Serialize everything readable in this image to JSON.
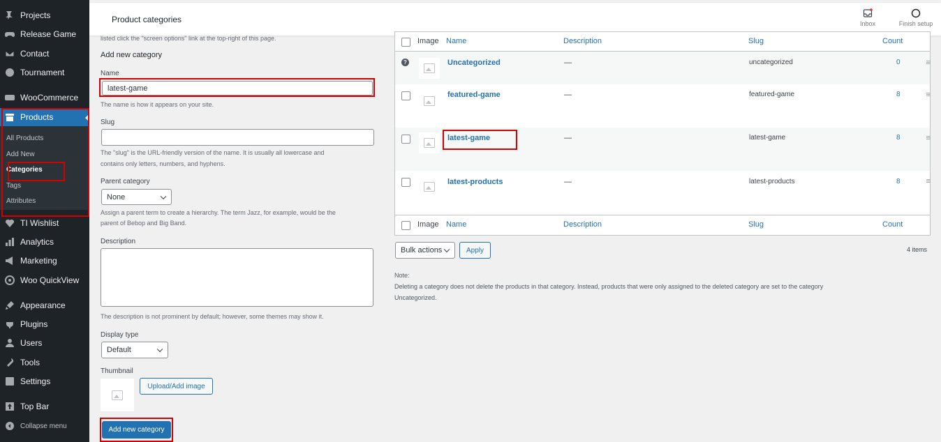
{
  "sidebar": {
    "items": [
      {
        "label": "Projects",
        "icon": "pin-icon"
      },
      {
        "label": "Release Game",
        "icon": "gamepad-icon"
      },
      {
        "label": "Contact",
        "icon": "mail-icon"
      },
      {
        "label": "Tournament",
        "icon": "trophy-icon"
      },
      {
        "label": "WooCommerce",
        "icon": "woo-icon"
      },
      {
        "label": "Products",
        "icon": "archive-icon"
      },
      {
        "label": "TI Wishlist",
        "icon": "heart-icon"
      },
      {
        "label": "Analytics",
        "icon": "chart-icon"
      },
      {
        "label": "Marketing",
        "icon": "megaphone-icon"
      },
      {
        "label": "Woo QuickView",
        "icon": "eye-icon"
      },
      {
        "label": "Appearance",
        "icon": "brush-icon"
      },
      {
        "label": "Plugins",
        "icon": "plug-icon"
      },
      {
        "label": "Users",
        "icon": "user-icon"
      },
      {
        "label": "Tools",
        "icon": "wrench-icon"
      },
      {
        "label": "Settings",
        "icon": "settings-icon"
      },
      {
        "label": "Top Bar",
        "icon": "upload-icon"
      }
    ],
    "submenu": [
      "All Products",
      "Add New",
      "Categories",
      "Tags",
      "Attributes"
    ],
    "collapse_label": "Collapse menu"
  },
  "header": {
    "title": "Product categories",
    "inbox_label": "Inbox",
    "finish_label": "Finish setup"
  },
  "form": {
    "intro_text": "listed click the \"screen options\" link at the top-right of this page.",
    "heading": "Add new category",
    "name_label": "Name",
    "name_value": "latest-game",
    "name_hint": "The name is how it appears on your site.",
    "slug_label": "Slug",
    "slug_value": "",
    "slug_hint_1": "The \"slug\" is the URL-friendly version of the name. It is usually all lowercase and",
    "slug_hint_2": "contains only letters, numbers, and hyphens.",
    "parent_label": "Parent category",
    "parent_value": "None",
    "parent_hint_1": "Assign a parent term to create a hierarchy. The term Jazz, for example, would be the",
    "parent_hint_2": "parent of Bebop and Big Band.",
    "description_label": "Description",
    "description_value": "",
    "description_hint": "The description is not prominent by default; however, some themes may show it.",
    "display_type_label": "Display type",
    "display_type_value": "Default",
    "thumbnail_label": "Thumbnail",
    "upload_label": "Upload/Add image",
    "submit_label": "Add new category"
  },
  "table": {
    "columns": {
      "image": "Image",
      "name": "Name",
      "description": "Description",
      "slug": "Slug",
      "count": "Count"
    },
    "rows": [
      {
        "name": "Uncategorized",
        "description": "—",
        "slug": "uncategorized",
        "count": "0"
      },
      {
        "name": "featured-game",
        "description": "—",
        "slug": "featured-game",
        "count": "8"
      },
      {
        "name": "latest-game",
        "description": "—",
        "slug": "latest-game",
        "count": "8"
      },
      {
        "name": "latest-products",
        "description": "—",
        "slug": "latest-products",
        "count": "8"
      }
    ],
    "bulk_actions_label": "Bulk actions",
    "apply_label": "Apply",
    "items_count": "4 items"
  },
  "note": {
    "title": "Note:",
    "line1": "Deleting a category does not delete the products in that category. Instead, products that were only assigned to the deleted category are set to the category",
    "line2": "Uncategorized."
  },
  "colors": {
    "accent": "#2271b1",
    "sidebar_bg": "#1d2327",
    "highlight_box": "#d60000"
  }
}
